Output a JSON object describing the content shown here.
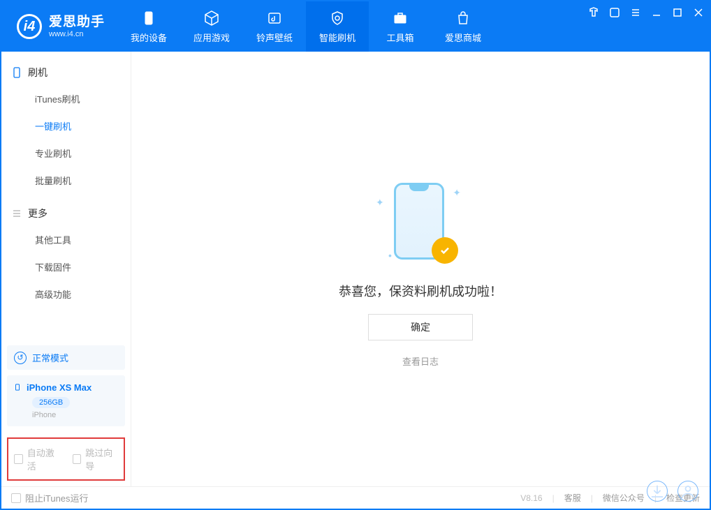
{
  "header": {
    "logo_cn": "爱思助手",
    "logo_url": "www.i4.cn",
    "tabs": [
      {
        "label": "我的设备"
      },
      {
        "label": "应用游戏"
      },
      {
        "label": "铃声壁纸"
      },
      {
        "label": "智能刷机"
      },
      {
        "label": "工具箱"
      },
      {
        "label": "爱思商城"
      }
    ]
  },
  "sidebar": {
    "group1_title": "刷机",
    "group1_items": [
      "iTunes刷机",
      "一键刷机",
      "专业刷机",
      "批量刷机"
    ],
    "group1_active_index": 1,
    "group2_title": "更多",
    "group2_items": [
      "其他工具",
      "下载固件",
      "高级功能"
    ],
    "mode_card": "正常模式",
    "device": {
      "name": "iPhone XS Max",
      "storage": "256GB",
      "type": "iPhone"
    },
    "checkbox1": "自动激活",
    "checkbox2": "跳过向导"
  },
  "main": {
    "success_msg": "恭喜您，保资料刷机成功啦！",
    "ok_button": "确定",
    "view_log": "查看日志"
  },
  "status": {
    "block_itunes": "阻止iTunes运行",
    "version": "V8.16",
    "links": [
      "客服",
      "微信公众号",
      "检查更新"
    ]
  }
}
